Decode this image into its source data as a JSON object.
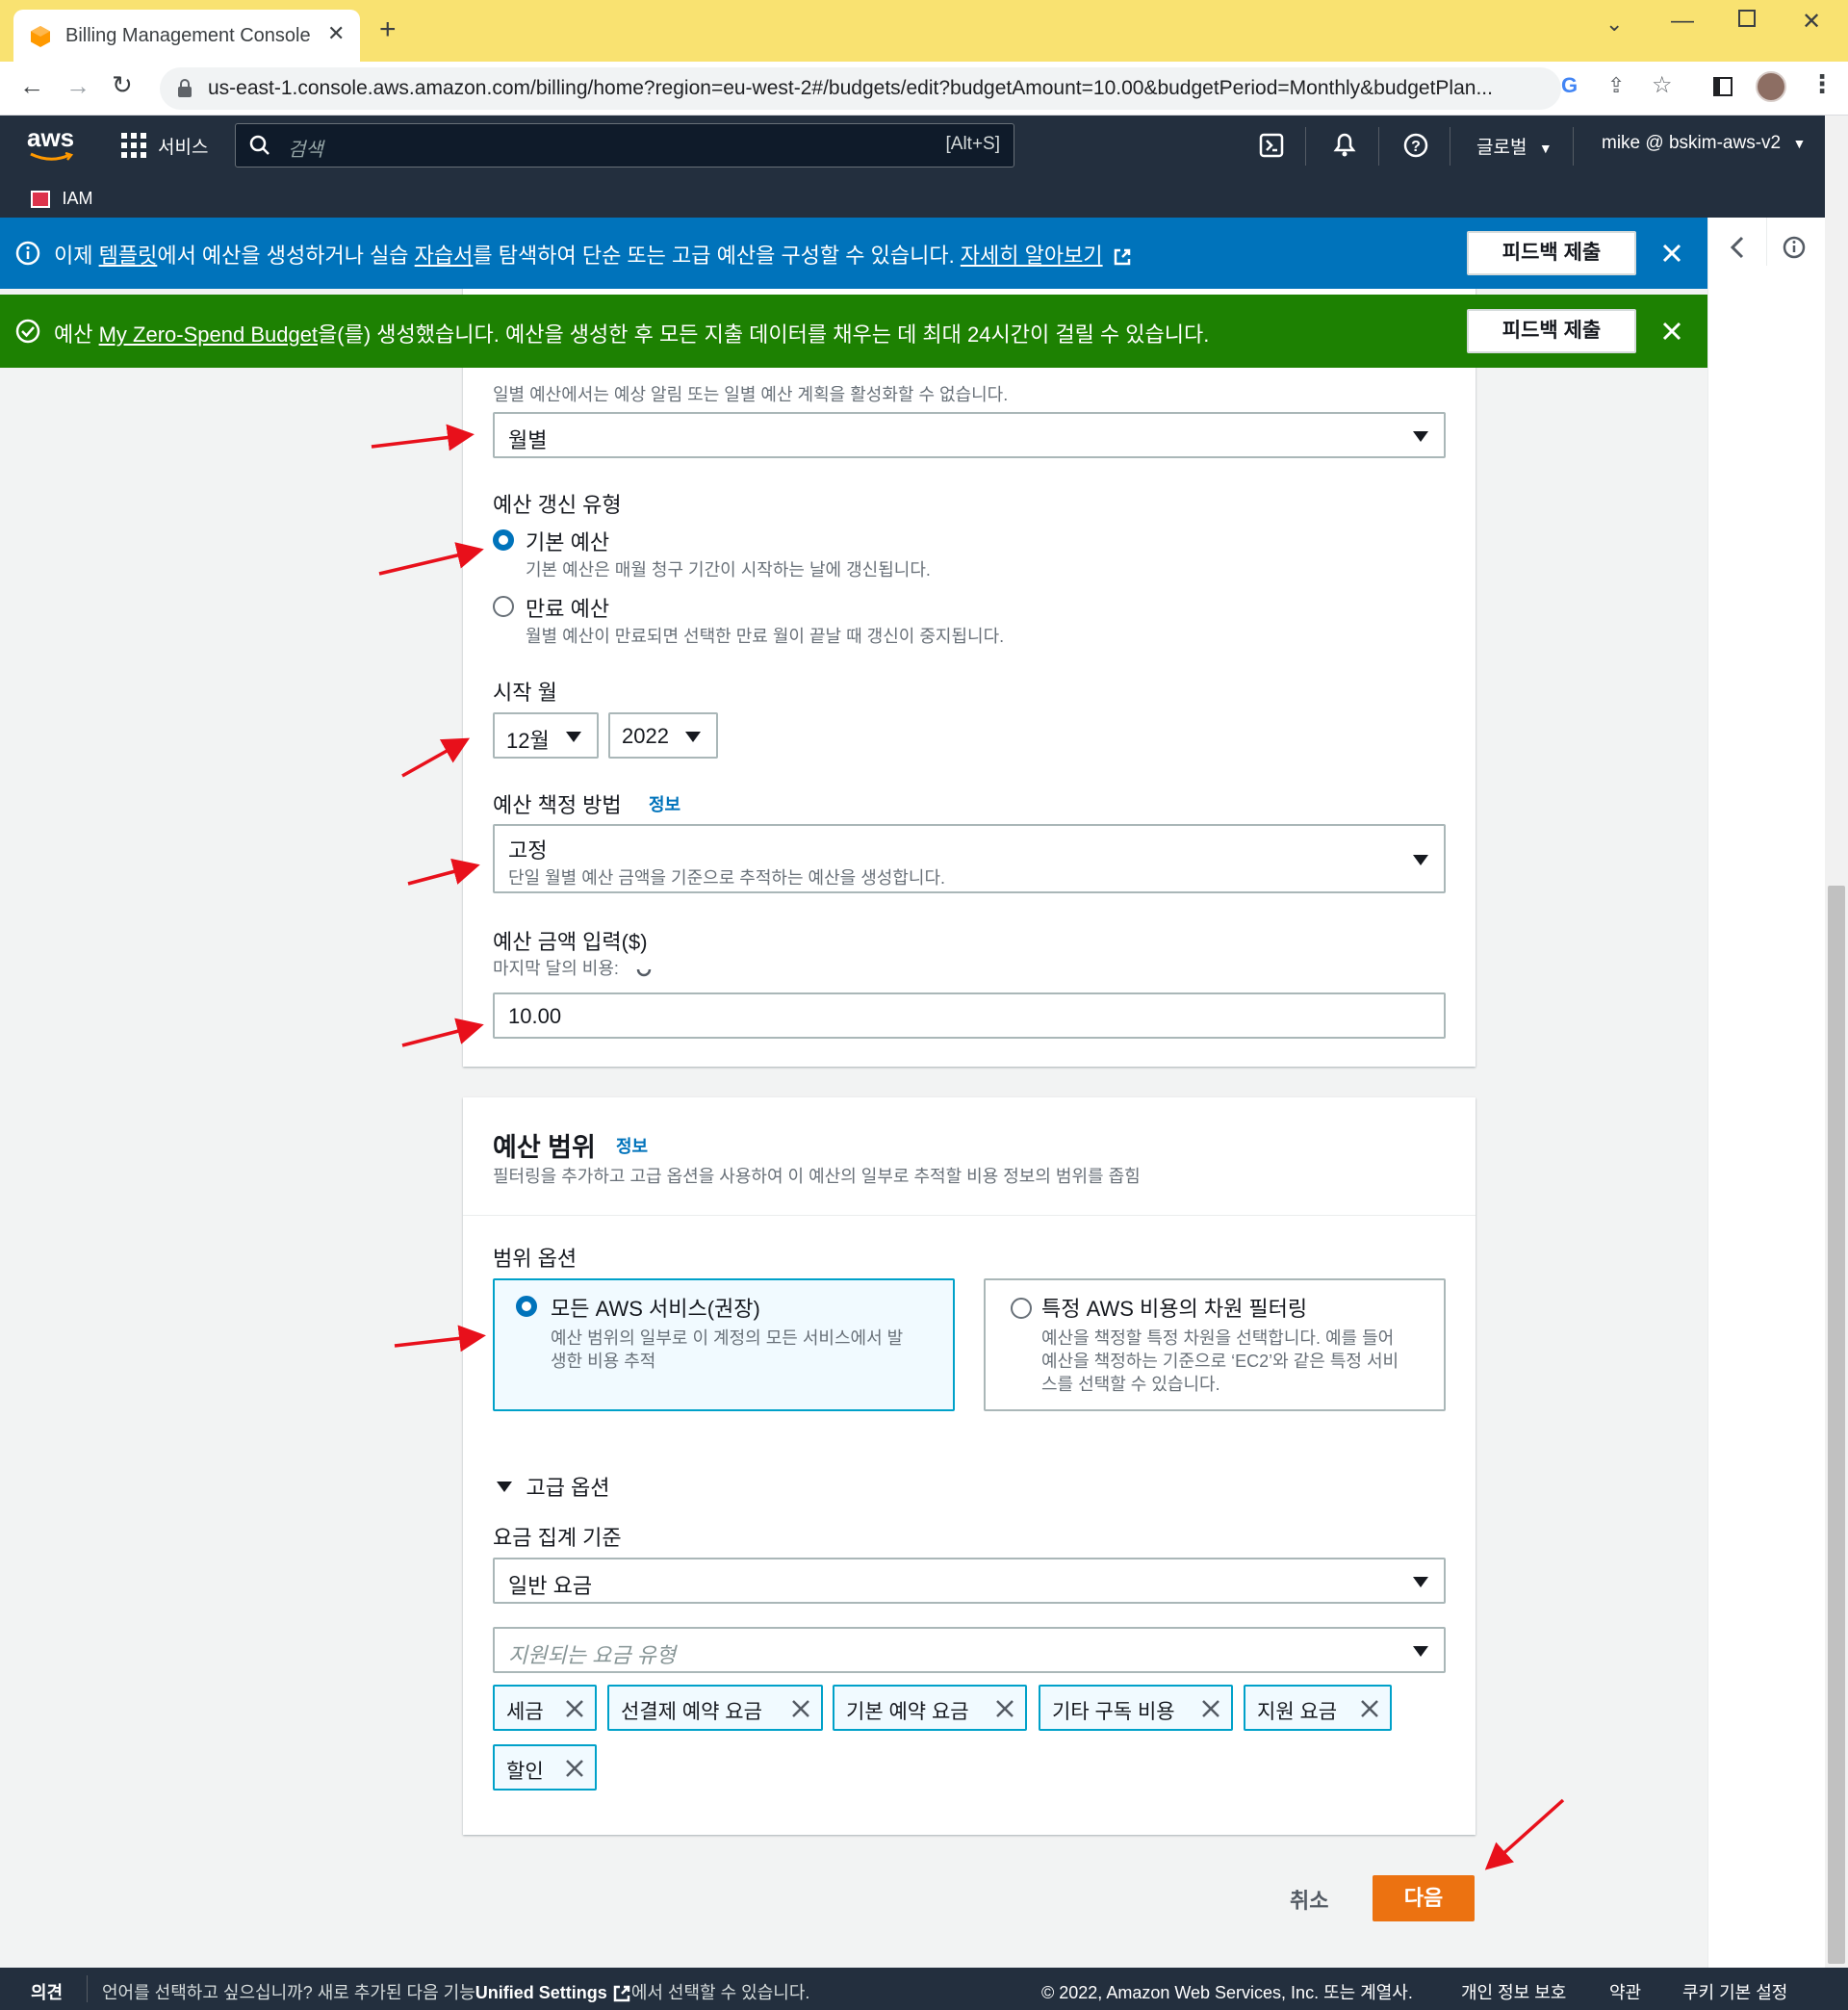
{
  "browser": {
    "tab_title": "Billing Management Console",
    "url": "us-east-1.console.aws.amazon.com/billing/home?region=eu-west-2#/budgets/edit?budgetAmount=10.00&budgetPeriod=Monthly&budgetPlan..."
  },
  "aws_nav": {
    "logo": "aws",
    "services_label": "서비스",
    "search_placeholder": "검색",
    "search_shortcut": "[Alt+S]",
    "region_label": "글로벌",
    "account_label": "mike @ bskim-aws-v2",
    "favorite": "IAM"
  },
  "flash_info": {
    "text_1": "이제 ",
    "link_1": "템플릿",
    "text_2": "에서 예산을 생성하거나 실습 ",
    "link_2": "자습서",
    "text_3": "를 탐색하여 단순 또는 고급 예산을 구성할 수 있습니다. ",
    "link_3": "자세히 알아보기",
    "button": "피드백 제출"
  },
  "flash_success": {
    "text_1": "예산 ",
    "link": "My Zero-Spend Budget",
    "text_2": "을(를) 생성했습니다. 예산을 생성한 후 모든 지출 데이터를 채우는 데 최대 24시간이 걸릴 수 있습니다.",
    "button": "피드백 제출"
  },
  "period": {
    "desc": "일별 예산에서는 예상 알림 또는 일별 예산 계획을 활성화할 수 없습니다.",
    "value": "월별"
  },
  "renewal": {
    "label": "예산 갱신 유형",
    "options": [
      {
        "title": "기본 예산",
        "desc": "기본 예산은 매월 청구 기간이 시작하는 날에 갱신됩니다.",
        "selected": true
      },
      {
        "title": "만료 예산",
        "desc": "월별 예산이 만료되면 선택한 만료 월이 끝날 때 갱신이 중지됩니다.",
        "selected": false
      }
    ]
  },
  "start_month": {
    "label": "시작 월",
    "month": "12월",
    "year": "2022"
  },
  "budgeting_method": {
    "label": "예산 책정 방법",
    "info": "정보",
    "value": "고정",
    "value_desc": "단일 월별 예산 금액을 기준으로 추적하는 예산을 생성합니다."
  },
  "amount": {
    "label": "예산 금액 입력($)",
    "sublabel": "마지막 달의 비용:",
    "value": "10.00"
  },
  "scope": {
    "title": "예산 범위",
    "info": "정보",
    "desc": "필터링을 추가하고 고급 옵션을 사용하여 이 예산의 일부로 추적할 비용 정보의 범위를 좁힘",
    "options_label": "범위 옵션",
    "option_all_title": "모든 AWS 서비스(권장)",
    "option_all_desc_1": "예산 범위의 일부로 이 계정의 모든 서비스에서 발",
    "option_all_desc_2": "생한 비용 추적",
    "option_filter_title": "특정 AWS 비용의 차원 필터링",
    "option_filter_desc_1": "예산을 책정할 특정 차원을 선택합니다. 예를 들어",
    "option_filter_desc_2": "예산을 책정하는 기준으로 ‘EC2’와 같은 특정 서비",
    "option_filter_desc_3": "스를 선택할 수 있습니다."
  },
  "advanced": {
    "toggle": "고급 옵션",
    "aggregate_label": "요금 집계 기준",
    "aggregate_value": "일반 요금",
    "charge_types_placeholder": "지원되는 요금 유형",
    "tokens": [
      "세금",
      "선결제 예약 요금",
      "기본 예약 요금",
      "기타 구독 비용",
      "지원 요금",
      "할인"
    ]
  },
  "actions": {
    "cancel": "취소",
    "next": "다음"
  },
  "footer": {
    "feedback": "의견",
    "lang_text_1": "언어를 선택하고 싶으십니까? 새로 추가된 다음 기능",
    "lang_link": "Unified Settings",
    "lang_text_2": "에서 선택할 수 있습니다.",
    "copyright": "© 2022, Amazon Web Services, Inc. 또는 계열사.",
    "privacy": "개인 정보 보호",
    "terms": "약관",
    "cookies": "쿠키 기본 설정"
  },
  "colors": {
    "accent": "#0073bb",
    "primary_button": "#ec7211",
    "success": "#1d8102",
    "nav": "#232f3e",
    "annotation_arrow": "#e8101b"
  }
}
